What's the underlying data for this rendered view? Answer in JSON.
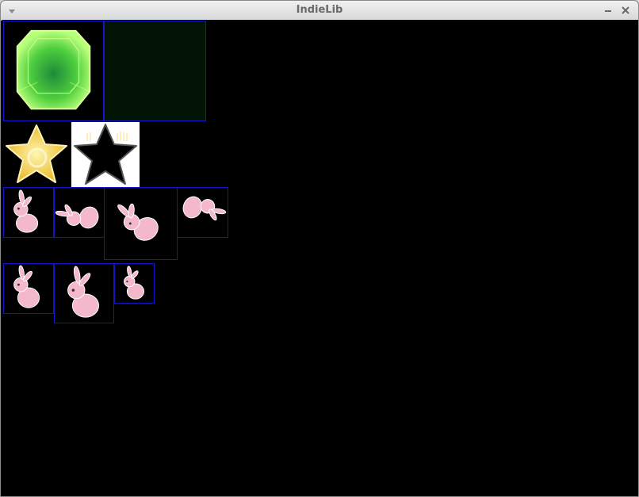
{
  "window": {
    "title": "IndieLib",
    "icons": [
      "window-menu-icon",
      "minimize-icon",
      "close-icon"
    ]
  },
  "sprites": [
    {
      "name": "green-gem-sprite",
      "icon": "green-gem"
    },
    {
      "name": "dark-green-tile-sprite",
      "icon": "dark-green-square"
    },
    {
      "name": "yellow-star-sprite",
      "icon": "yellow-star"
    },
    {
      "name": "black-star-on-white-sprite",
      "icon": "black-star"
    },
    {
      "name": "rabbit-sprite",
      "icon": "pink-rabbit"
    }
  ],
  "colors": {
    "canvas": "#000000",
    "sprite_border": "#1414c8",
    "rabbit": "#f4b8cc",
    "gem": "#5fd34a",
    "star": "#f2d23a"
  }
}
